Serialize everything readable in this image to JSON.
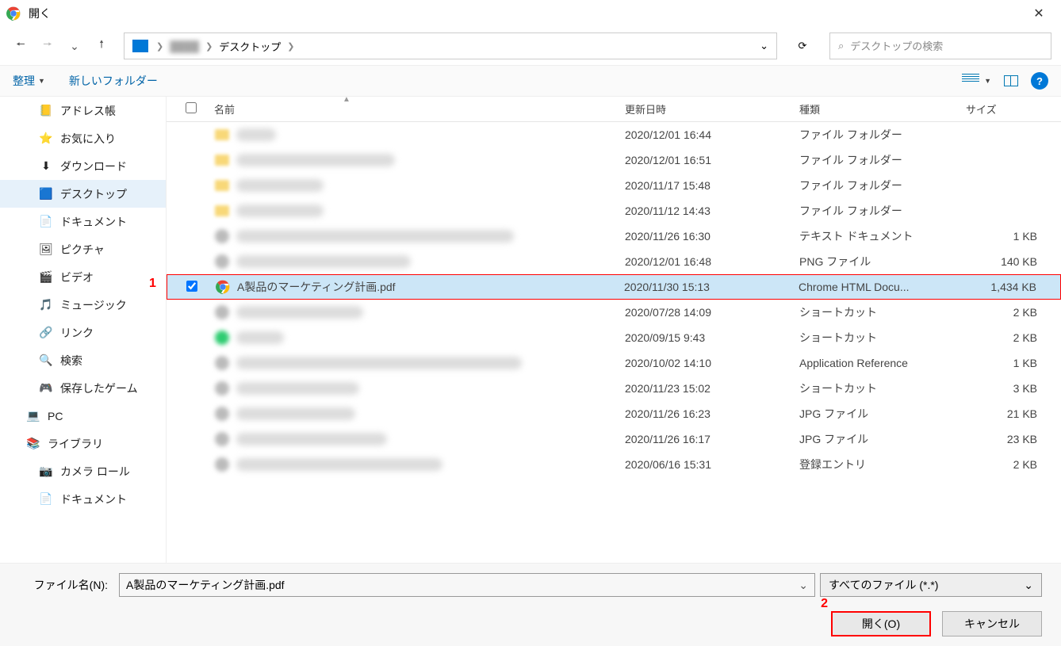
{
  "title": "開く",
  "breadcrumb": {
    "item": "デスクトップ"
  },
  "search_placeholder": "デスクトップの検索",
  "toolbar": {
    "organize": "整理",
    "newfolder": "新しいフォルダー"
  },
  "columns": {
    "name": "名前",
    "date": "更新日時",
    "kind": "種類",
    "size": "サイズ"
  },
  "sidebar": [
    {
      "label": "アドレス帳",
      "icon": "addressbook"
    },
    {
      "label": "お気に入り",
      "icon": "favorites"
    },
    {
      "label": "ダウンロード",
      "icon": "download"
    },
    {
      "label": "デスクトップ",
      "icon": "desktop",
      "selected": true
    },
    {
      "label": "ドキュメント",
      "icon": "document"
    },
    {
      "label": "ピクチャ",
      "icon": "pictures"
    },
    {
      "label": "ビデオ",
      "icon": "video"
    },
    {
      "label": "ミュージック",
      "icon": "music"
    },
    {
      "label": "リンク",
      "icon": "links"
    },
    {
      "label": "検索",
      "icon": "search"
    },
    {
      "label": "保存したゲーム",
      "icon": "games"
    },
    {
      "label": "PC",
      "icon": "pc",
      "top": true
    },
    {
      "label": "ライブラリ",
      "icon": "library",
      "top": true
    },
    {
      "label": "カメラ ロール",
      "icon": "camera"
    },
    {
      "label": "ドキュメント",
      "icon": "document"
    }
  ],
  "files": [
    {
      "blur": true,
      "date": "2020/12/01 16:44",
      "kind": "ファイル フォルダー",
      "size": "",
      "icon": "folder",
      "bw": 50
    },
    {
      "blur": true,
      "date": "2020/12/01 16:51",
      "kind": "ファイル フォルダー",
      "size": "",
      "icon": "folder",
      "bw": 200
    },
    {
      "blur": true,
      "date": "2020/11/17 15:48",
      "kind": "ファイル フォルダー",
      "size": "",
      "icon": "folder",
      "bw": 110
    },
    {
      "blur": true,
      "date": "2020/11/12 14:43",
      "kind": "ファイル フォルダー",
      "size": "",
      "icon": "folder",
      "bw": 110
    },
    {
      "blur": true,
      "date": "2020/11/26 16:30",
      "kind": "テキスト ドキュメント",
      "size": "1 KB",
      "icon": "text",
      "bw": 350
    },
    {
      "blur": true,
      "date": "2020/12/01 16:48",
      "kind": "PNG ファイル",
      "size": "140 KB",
      "icon": "png",
      "bw": 220
    },
    {
      "selected": true,
      "name": "A製品のマーケティング計画.pdf",
      "date": "2020/11/30 15:13",
      "kind": "Chrome HTML Docu...",
      "size": "1,434 KB",
      "icon": "chrome"
    },
    {
      "blur": true,
      "date": "2020/07/28 14:09",
      "kind": "ショートカット",
      "size": "2 KB",
      "icon": "shortcut",
      "bw": 160
    },
    {
      "blur": true,
      "date": "2020/09/15 9:43",
      "kind": "ショートカット",
      "size": "2 KB",
      "icon": "green",
      "bw": 60
    },
    {
      "blur": true,
      "date": "2020/10/02 14:10",
      "kind": "Application Reference",
      "size": "1 KB",
      "icon": "app",
      "bw": 360
    },
    {
      "blur": true,
      "date": "2020/11/23 15:02",
      "kind": "ショートカット",
      "size": "3 KB",
      "icon": "shortcut",
      "bw": 155
    },
    {
      "blur": true,
      "date": "2020/11/26 16:23",
      "kind": "JPG ファイル",
      "size": "21 KB",
      "icon": "jpg",
      "bw": 150
    },
    {
      "blur": true,
      "date": "2020/11/26 16:17",
      "kind": "JPG ファイル",
      "size": "23 KB",
      "icon": "jpg",
      "bw": 190
    },
    {
      "blur": true,
      "date": "2020/06/16 15:31",
      "kind": "登録エントリ",
      "size": "2 KB",
      "icon": "reg",
      "bw": 260
    }
  ],
  "footer": {
    "filename_label": "ファイル名(N):",
    "filename_value": "A製品のマーケティング計画.pdf",
    "filter": "すべてのファイル (*.*)",
    "open": "開く(O)",
    "cancel": "キャンセル"
  },
  "annotations": {
    "one": "1",
    "two": "2"
  }
}
